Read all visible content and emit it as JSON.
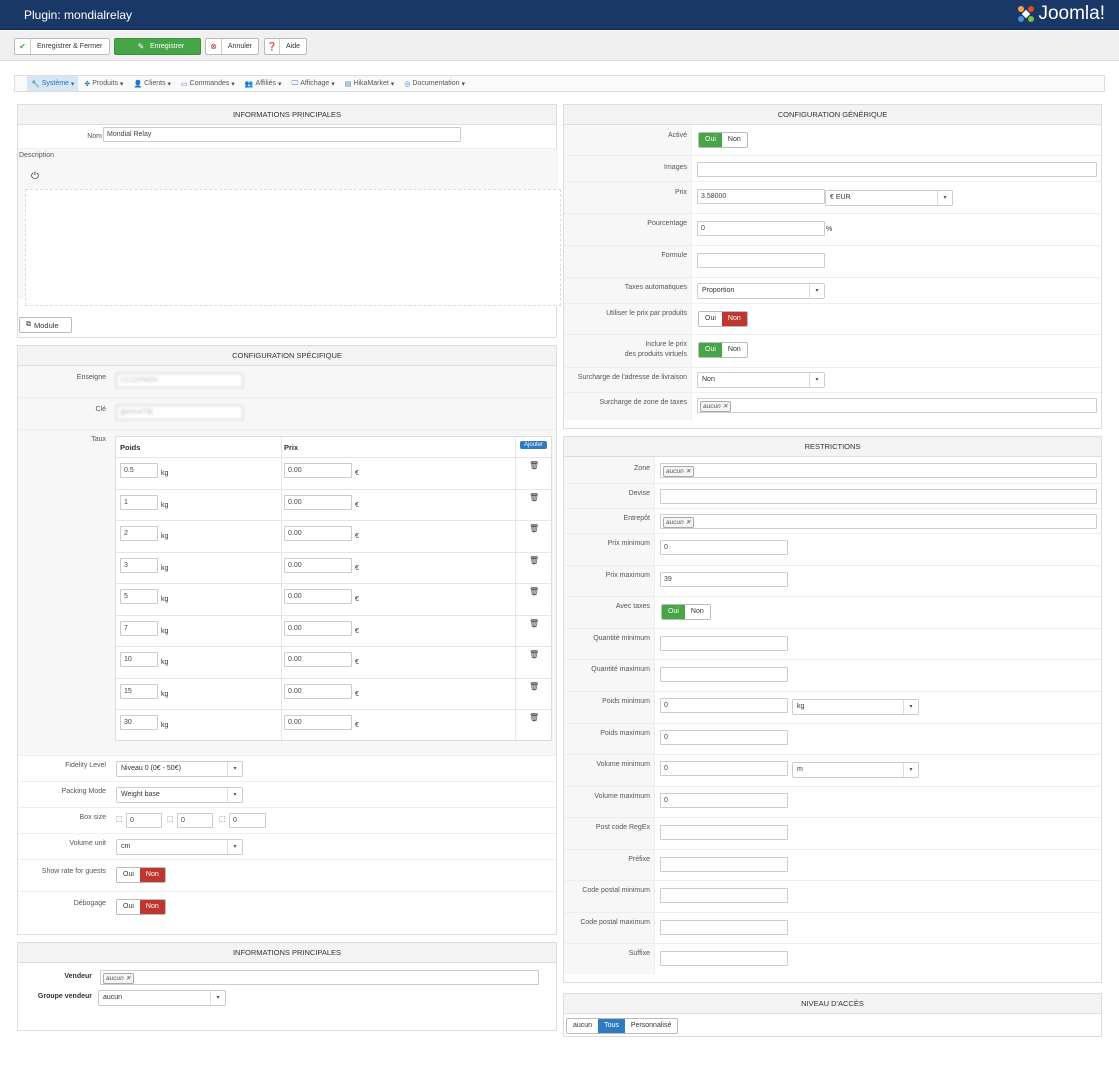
{
  "header": {
    "title": "Plugin: mondialrelay",
    "logo_text": "Joomla!"
  },
  "toolbar": {
    "save_close": "Enregistrer & Fermer",
    "save": "Enregistrer",
    "cancel": "Annuler",
    "help": "Aide"
  },
  "menu": [
    "Système",
    "Produits",
    "Clients",
    "Commandes",
    "Affiliés",
    "Affichage",
    "HikaMarket",
    "Documentation"
  ],
  "main_info": {
    "title": "INFORMATIONS PRINCIPALES",
    "name_label": "Nom",
    "name_value": "Mondial Relay",
    "description_label": "Description",
    "module_button": "Module"
  },
  "specific": {
    "title": "CONFIGURATION SPÉCIFIQUE",
    "enseigne_label": "Enseigne",
    "enseigne_value": "CC22PMZH",
    "cle_label": "Clé",
    "cle_value": "gbHm4TtE",
    "taux_label": "Taux",
    "col_weight": "Poids",
    "col_price": "Prix",
    "add_button": "Ajouter",
    "weight_unit": "kg",
    "currency_symbol": "€",
    "rates": [
      {
        "weight": "0.5",
        "price": "0.00"
      },
      {
        "weight": "1",
        "price": "0.00"
      },
      {
        "weight": "2",
        "price": "0.00"
      },
      {
        "weight": "3",
        "price": "0.00"
      },
      {
        "weight": "5",
        "price": "0.00"
      },
      {
        "weight": "7",
        "price": "0.00"
      },
      {
        "weight": "10",
        "price": "0.00"
      },
      {
        "weight": "15",
        "price": "0.00"
      },
      {
        "weight": "30",
        "price": "0.00"
      }
    ],
    "fidelity_label": "Fidelity Level",
    "fidelity_value": "Niveau 0 (0€ - 50€)",
    "packing_label": "Packing Mode",
    "packing_value": "Weight base",
    "box_label": "Box size",
    "box_values": [
      "0",
      "0",
      "0"
    ],
    "volume_unit_label": "Volume unit",
    "volume_unit_value": "cm",
    "guests_label": "Show rate for guests",
    "debug_label": "Débogage",
    "yes": "Oui",
    "no": "Non"
  },
  "vendor": {
    "title": "INFORMATIONS PRINCIPALES",
    "vendor_label": "Vendeur",
    "vendor_tag": "aucun",
    "group_label": "Groupe vendeur",
    "group_value": "aucun"
  },
  "generic": {
    "title": "CONFIGURATION GÉNÉRIQUE",
    "active_label": "Activé",
    "images_label": "Images",
    "price_label": "Prix",
    "price_value": "3.58000",
    "currency_value": "€ EUR",
    "percent_label": "Pourcentage",
    "percent_value": "0",
    "percent_sign": "%",
    "formula_label": "Formule",
    "auto_tax_label": "Taxes automatiques",
    "auto_tax_value": "Proportion",
    "use_product_price_label": "Utiliser le prix par produits",
    "include_virtual_label_1": "Inclure le prix",
    "include_virtual_label_2": "des produits virtuels",
    "override_address_label": "Surcharge de l'adresse de livraison",
    "override_address_value": "Non",
    "override_tax_zone_label": "Surcharge de zone de taxes",
    "override_tax_zone_tag": "aucun"
  },
  "restrictions": {
    "title": "RESTRICTIONS",
    "zone_label": "Zone",
    "zone_tag": "aucun",
    "currency_label": "Devise",
    "warehouse_label": "Entrepôt",
    "warehouse_tag": "aucun",
    "min_price_label": "Prix minimum",
    "min_price_value": "0",
    "max_price_label": "Prix maximum",
    "max_price_value": "39",
    "with_tax_label": "Avec taxes",
    "min_qty_label": "Quantité minimum",
    "max_qty_label": "Quantité maximum",
    "min_weight_label": "Poids minimum",
    "min_weight_value": "0",
    "weight_unit": "kg",
    "max_weight_label": "Poids maximum",
    "max_weight_value": "0",
    "min_volume_label": "Volume minimum",
    "min_volume_value": "0",
    "volume_unit": "m",
    "max_volume_label": "Volume maximum",
    "max_volume_value": "0",
    "postcode_regex_label": "Post code RegEx",
    "prefix_label": "Préfixe",
    "min_postcode_label": "Code postal minimum",
    "max_postcode_label": "Code postal maximum",
    "suffix_label": "Suffixe"
  },
  "access": {
    "title": "NIVEAU D'ACCÈS",
    "options": [
      "aucun",
      "Tous",
      "Personnalisé"
    ]
  }
}
